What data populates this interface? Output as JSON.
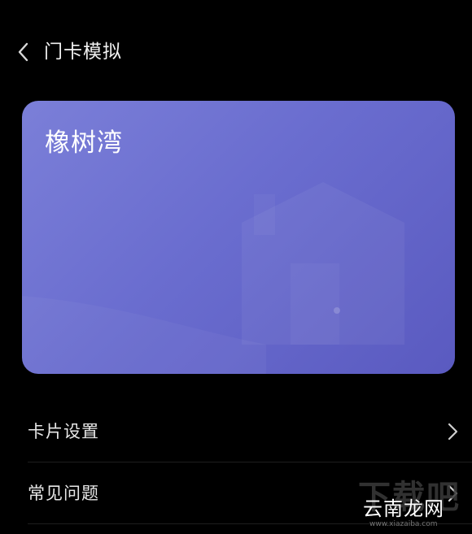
{
  "header": {
    "title": "门卡模拟",
    "back_icon": "chevron-left-icon"
  },
  "card": {
    "name": "橡树湾",
    "gradient_colors": [
      "#7b7fd8",
      "#6a6dcf",
      "#5a5ac0"
    ],
    "art_icon": "house-icon"
  },
  "menu": {
    "items": [
      {
        "label": "卡片设置",
        "icon": "chevron-right-icon"
      },
      {
        "label": "常见问题",
        "icon": "chevron-right-icon"
      }
    ]
  },
  "watermark": {
    "background_text": "下载吧",
    "main_text": "云南龙网",
    "url": "www.xiazaiba.com"
  }
}
